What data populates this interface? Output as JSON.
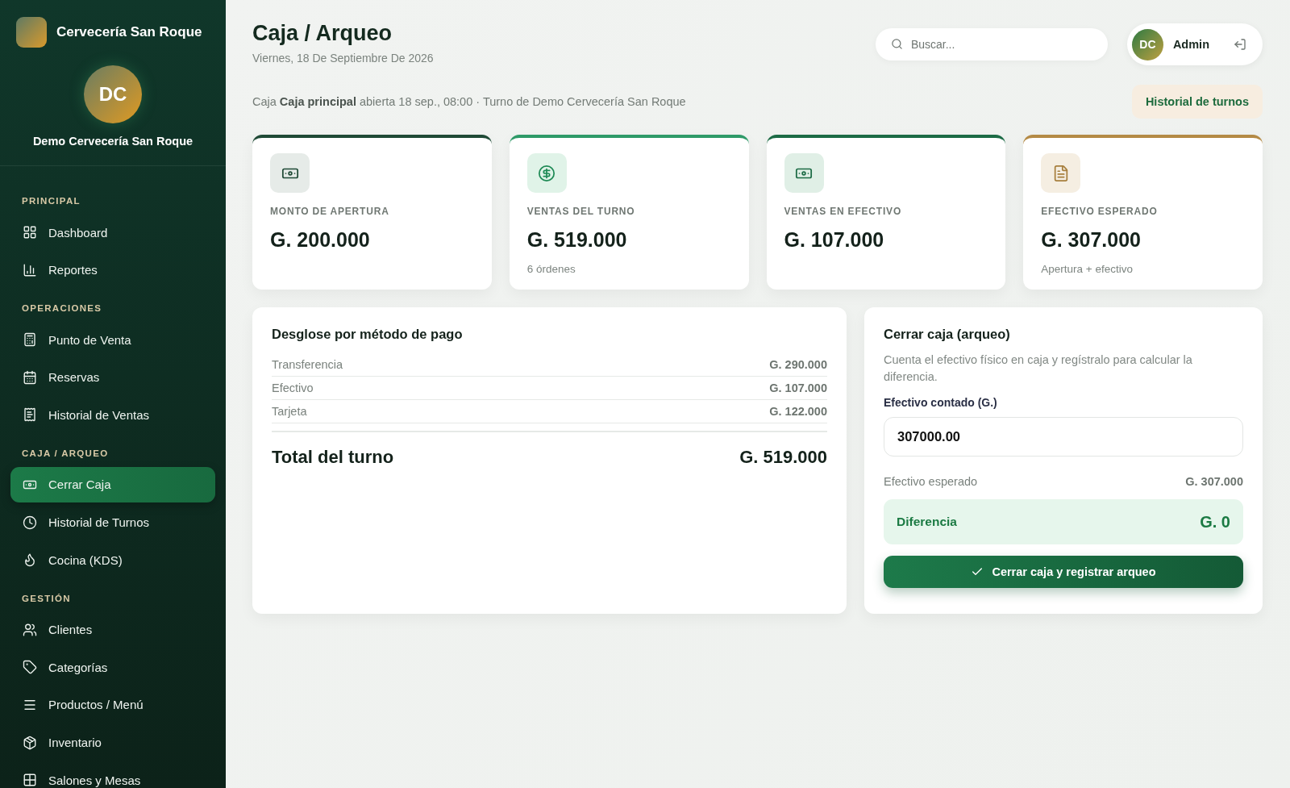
{
  "brand": {
    "name": "Cervecería San Roque"
  },
  "profile": {
    "initials": "DC",
    "name": "Demo Cervecería San Roque"
  },
  "nav": [
    {
      "title": "PRINCIPAL",
      "items": [
        {
          "label": "Dashboard",
          "selected": false
        },
        {
          "label": "Reportes",
          "selected": false
        }
      ]
    },
    {
      "title": "OPERACIONES",
      "items": [
        {
          "label": "Punto de Venta",
          "selected": false
        },
        {
          "label": "Reservas",
          "selected": false
        },
        {
          "label": "Historial de Ventas",
          "selected": false
        }
      ]
    },
    {
      "title": "CAJA / ARQUEO",
      "items": [
        {
          "label": "Cerrar Caja",
          "selected": true
        },
        {
          "label": "Historial de Turnos",
          "selected": false
        },
        {
          "label": "Cocina (KDS)",
          "selected": false
        }
      ]
    },
    {
      "title": "GESTIÓN",
      "items": [
        {
          "label": "Clientes",
          "selected": false
        },
        {
          "label": "Categorías",
          "selected": false
        },
        {
          "label": "Productos / Menú",
          "selected": false
        },
        {
          "label": "Inventario",
          "selected": false
        },
        {
          "label": "Salones y Mesas",
          "selected": false
        }
      ]
    }
  ],
  "header": {
    "title": "Caja / Arqueo",
    "date": "Viernes, 18 De Septiembre De 2026"
  },
  "search": {
    "placeholder": "Buscar..."
  },
  "user": {
    "initials": "DC",
    "name": "Admin"
  },
  "session": {
    "text": "Caja **Caja principal** abierta 18 sep., 08:00 · Turno de Demo Cervecería San Roque",
    "button": "Historial de turnos"
  },
  "stats": [
    {
      "label": "MONTO DE APERTURA",
      "value": "G. 200.000",
      "color": "#1f4a36"
    },
    {
      "label": "VENTAS DEL TURNO",
      "value": "G. 519.000",
      "note": "6 órdenes",
      "color": "#2e9a68"
    },
    {
      "label": "VENTAS EN EFECTIVO",
      "value": "G. 107.000",
      "color": "#1c6b45"
    },
    {
      "label": "EFECTIVO ESPERADO",
      "value": "G. 307.000",
      "note": "Apertura + efectivo",
      "color": "#b48a45"
    }
  ],
  "breakdown": {
    "title": "Desglose por método de pago",
    "rows": [
      {
        "method": "Transferencia",
        "amount": "G. 290.000"
      },
      {
        "method": "Efectivo",
        "amount": "G. 107.000"
      },
      {
        "method": "Tarjeta",
        "amount": "G. 122.000"
      }
    ],
    "total_label": "Total del turno",
    "total": "G. 519.000"
  },
  "close": {
    "title": "Cerrar caja (arqueo)",
    "description": "Cuenta el efectivo físico en caja y regístralo para calcular la diferencia.",
    "field_label": "Efectivo contado (G.)",
    "value": "307000.00",
    "expected_label": "Efectivo esperado",
    "expected": "G. 307.000",
    "difference_label": "Diferencia",
    "difference": "G. 0",
    "button": "Cerrar caja y registrar arqueo"
  }
}
